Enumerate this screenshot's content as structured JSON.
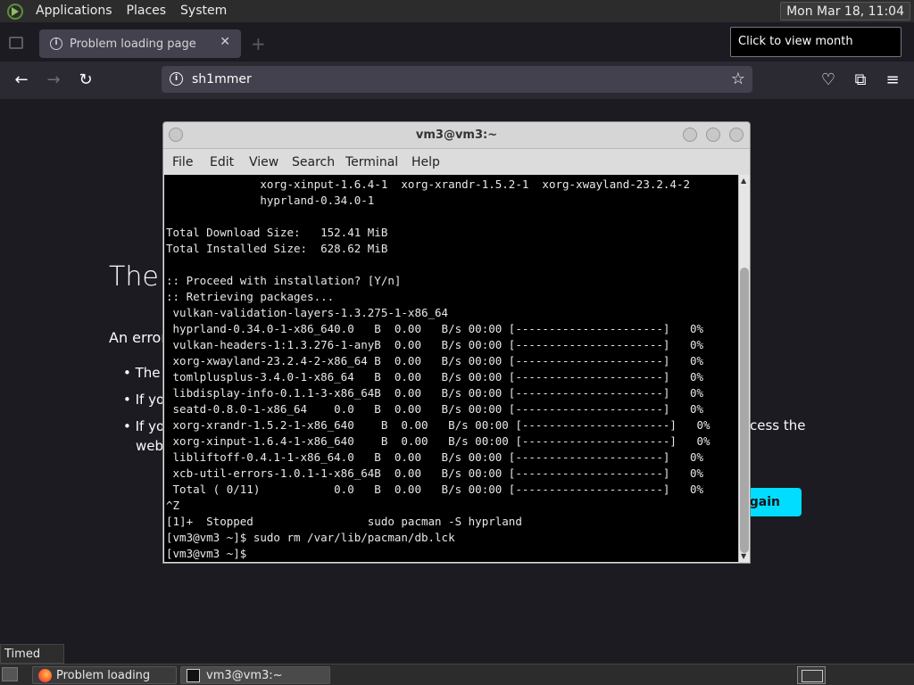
{
  "top_panel": {
    "menus": [
      "Applications",
      "Places",
      "System"
    ],
    "clock": "Mon Mar 18, 11:04"
  },
  "tooltip": "Click to view month calendar",
  "browser": {
    "tab_title": "Problem loading page",
    "url": "sh1mmer"
  },
  "error_page": {
    "title": "The",
    "description": "An error",
    "bullets": [
      "The",
      "If you",
      "If you",
      "web"
    ],
    "bullet_extra": "cess the",
    "try_again": "Again"
  },
  "terminal": {
    "title": "vm3@vm3:~",
    "menu": [
      "File",
      "Edit",
      "View",
      "Search",
      "Terminal",
      "Help"
    ],
    "lines": [
      "              xorg-xinput-1.6.4-1  xorg-xrandr-1.5.2-1  xorg-xwayland-23.2.4-2",
      "              hyprland-0.34.0-1",
      "",
      "Total Download Size:   152.41 MiB",
      "Total Installed Size:  628.62 MiB",
      "",
      ":: Proceed with installation? [Y/n]",
      ":: Retrieving packages...",
      " vulkan-validation-layers-1.3.275-1-x86_64",
      " hyprland-0.34.0-1-x86_640.0   B  0.00   B/s 00:00 [----------------------]   0%",
      " vulkan-headers-1:1.3.276-1-anyB  0.00   B/s 00:00 [----------------------]   0%",
      " xorg-xwayland-23.2.4-2-x86_64 B  0.00   B/s 00:00 [----------------------]   0%",
      " tomlplusplus-3.4.0-1-x86_64   B  0.00   B/s 00:00 [----------------------]   0%",
      " libdisplay-info-0.1.1-3-x86_64B  0.00   B/s 00:00 [----------------------]   0%",
      " seatd-0.8.0-1-x86_64    0.0   B  0.00   B/s 00:00 [----------------------]   0%",
      " xorg-xrandr-1.5.2-1-x86_640    B  0.00   B/s 00:00 [----------------------]   0%",
      " xorg-xinput-1.6.4-1-x86_640    B  0.00   B/s 00:00 [----------------------]   0%",
      " libliftoff-0.4.1-1-x86_64.0   B  0.00   B/s 00:00 [----------------------]   0%",
      " xcb-util-errors-1.0.1-1-x86_64B  0.00   B/s 00:00 [----------------------]   0%",
      " Total ( 0/11)           0.0   B  0.00   B/s 00:00 [----------------------]   0%",
      "^Z",
      "[1]+  Stopped                 sudo pacman -S hyprland",
      "[vm3@vm3 ~]$ sudo rm /var/lib/pacman/db.lck",
      "[vm3@vm3 ~]$"
    ]
  },
  "bottom_panel": {
    "status": "Timed Out",
    "tasks": [
      "Problem loading pa...",
      "vm3@vm3:~"
    ]
  }
}
